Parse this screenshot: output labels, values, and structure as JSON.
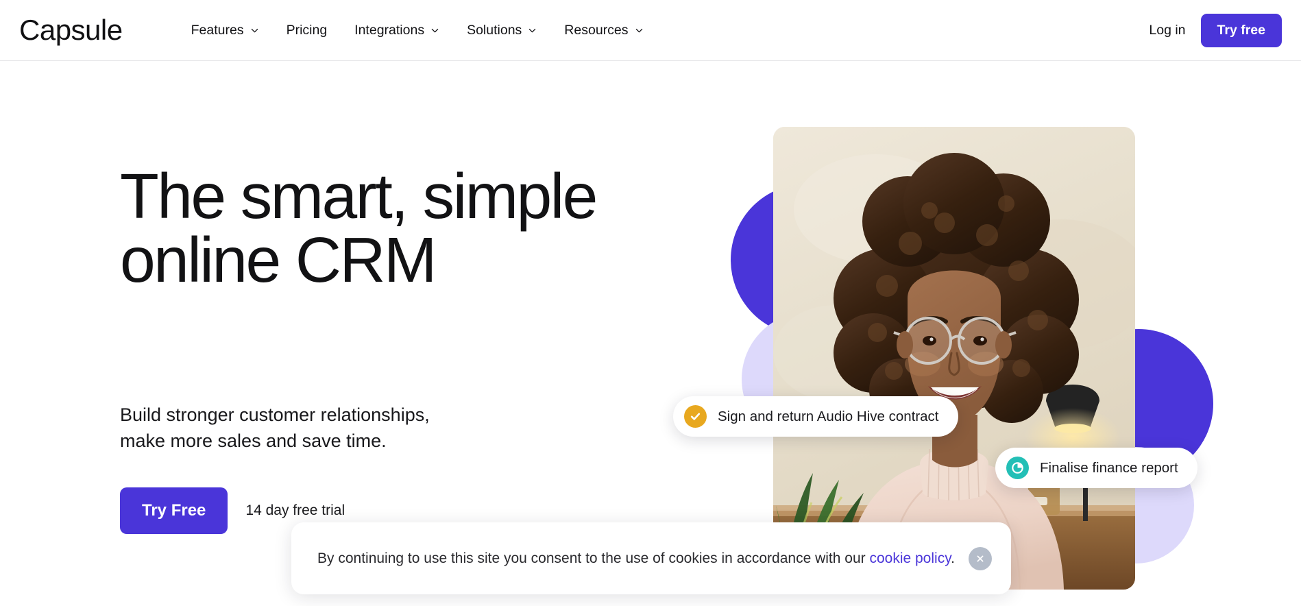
{
  "brand": {
    "logo_text": "Capsule",
    "accent_color": "#4a35d9",
    "accent_light_color": "#ddd9fb",
    "text_color": "#121214"
  },
  "header": {
    "nav_items": [
      {
        "label": "Features",
        "has_dropdown": true,
        "icon": "chevron-down-icon"
      },
      {
        "label": "Pricing",
        "has_dropdown": false,
        "icon": ""
      },
      {
        "label": "Integrations",
        "has_dropdown": true,
        "icon": "chevron-down-icon"
      },
      {
        "label": "Solutions",
        "has_dropdown": true,
        "icon": "chevron-down-icon"
      },
      {
        "label": "Resources",
        "has_dropdown": true,
        "icon": "chevron-down-icon"
      }
    ],
    "login_label": "Log in",
    "cta_label": "Try free"
  },
  "hero": {
    "title_line_1": "The smart, simple",
    "title_line_2": "online CRM",
    "subtitle_line_1": "Build stronger customer relationships,",
    "subtitle_line_2": "make more sales and save time.",
    "cta_label": "Try Free",
    "trial_note": "14 day free trial"
  },
  "floating_tasks": [
    {
      "label": "Sign and return Audio Hive contract",
      "icon": "check-circle-icon",
      "icon_color": "#e8a81f"
    },
    {
      "label": "Finalise finance report",
      "icon": "pie-chart-circle-icon",
      "icon_color": "#23bfb6"
    }
  ],
  "cookie_banner": {
    "text_before_link": "By continuing to use this site you consent to the use of cookies in accordance with our ",
    "link_label": "cookie policy",
    "text_after_link": ".",
    "close_icon": "close-icon"
  },
  "hero_image": {
    "alt": "Smiling woman with afro hair and round glasses wearing a cream turtleneck, sitting at a desk with a plant and a desk lamp"
  }
}
